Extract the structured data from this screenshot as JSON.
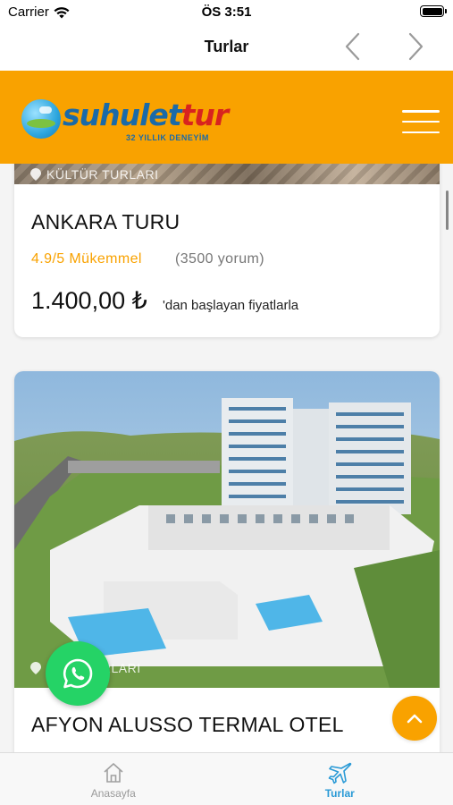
{
  "status_bar": {
    "carrier": "Carrier",
    "time": "ÖS 3:51"
  },
  "nav": {
    "title": "Turlar"
  },
  "header": {
    "logo_part1": "suhulet",
    "logo_part2": "tur",
    "logo_tagline": "32 YILLIK DENEYİM"
  },
  "tours": [
    {
      "category": "KÜLTÜR TURLARI",
      "title": "ANKARA TURU",
      "rating": "4.9/5 Mükemmel",
      "reviews": "(3500 yorum)",
      "price": "1.400,00 ₺",
      "price_note": "'dan başlayan fiyatlarla"
    },
    {
      "category": "OTEL TURLARI",
      "title": "AFYON ALUSSO TERMAL OTEL"
    }
  ],
  "tab_bar": {
    "items": [
      {
        "label": "Anasayfa"
      },
      {
        "label": "Turlar"
      }
    ]
  },
  "colors": {
    "accent": "#f9a200",
    "whatsapp": "#25d366",
    "active_tab": "#2a9ad6"
  }
}
